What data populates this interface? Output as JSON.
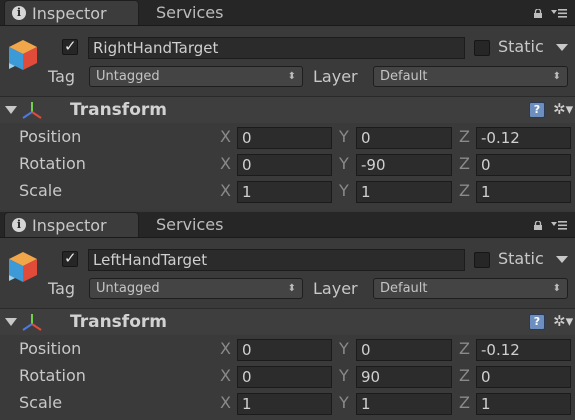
{
  "inspectors": [
    {
      "tabs": {
        "active": "Inspector",
        "inactive": "Services"
      },
      "object": {
        "name": "RightHandTarget",
        "active": true,
        "static_label": "Static",
        "static": false
      },
      "tag": {
        "label": "Tag",
        "value": "Untagged"
      },
      "layer": {
        "label": "Layer",
        "value": "Default"
      },
      "transform": {
        "title": "Transform",
        "rows": [
          {
            "label": "Position",
            "x": "0",
            "y": "0",
            "z": "-0.12"
          },
          {
            "label": "Rotation",
            "x": "0",
            "y": "-90",
            "z": "0"
          },
          {
            "label": "Scale",
            "x": "1",
            "y": "1",
            "z": "1"
          }
        ]
      }
    },
    {
      "tabs": {
        "active": "Inspector",
        "inactive": "Services"
      },
      "object": {
        "name": "LeftHandTarget",
        "active": true,
        "static_label": "Static",
        "static": false
      },
      "tag": {
        "label": "Tag",
        "value": "Untagged"
      },
      "layer": {
        "label": "Layer",
        "value": "Default"
      },
      "transform": {
        "title": "Transform",
        "rows": [
          {
            "label": "Position",
            "x": "0",
            "y": "0",
            "z": "-0.12"
          },
          {
            "label": "Rotation",
            "x": "0",
            "y": "90",
            "z": "0"
          },
          {
            "label": "Scale",
            "x": "1",
            "y": "1",
            "z": "1"
          }
        ]
      }
    }
  ],
  "axis_labels": {
    "x": "X",
    "y": "Y",
    "z": "Z"
  },
  "icons": {
    "info": "info-icon",
    "lock": "lock-icon",
    "menu": "menu-icon",
    "cube": "gameobject-cube-icon",
    "axes": "transform-axes-icon",
    "help": "help-icon",
    "gear": "gear-icon"
  },
  "glyphs": {
    "info": "i",
    "check": "✓",
    "updown": "⬍",
    "help": "?",
    "gear": "✲▾"
  }
}
